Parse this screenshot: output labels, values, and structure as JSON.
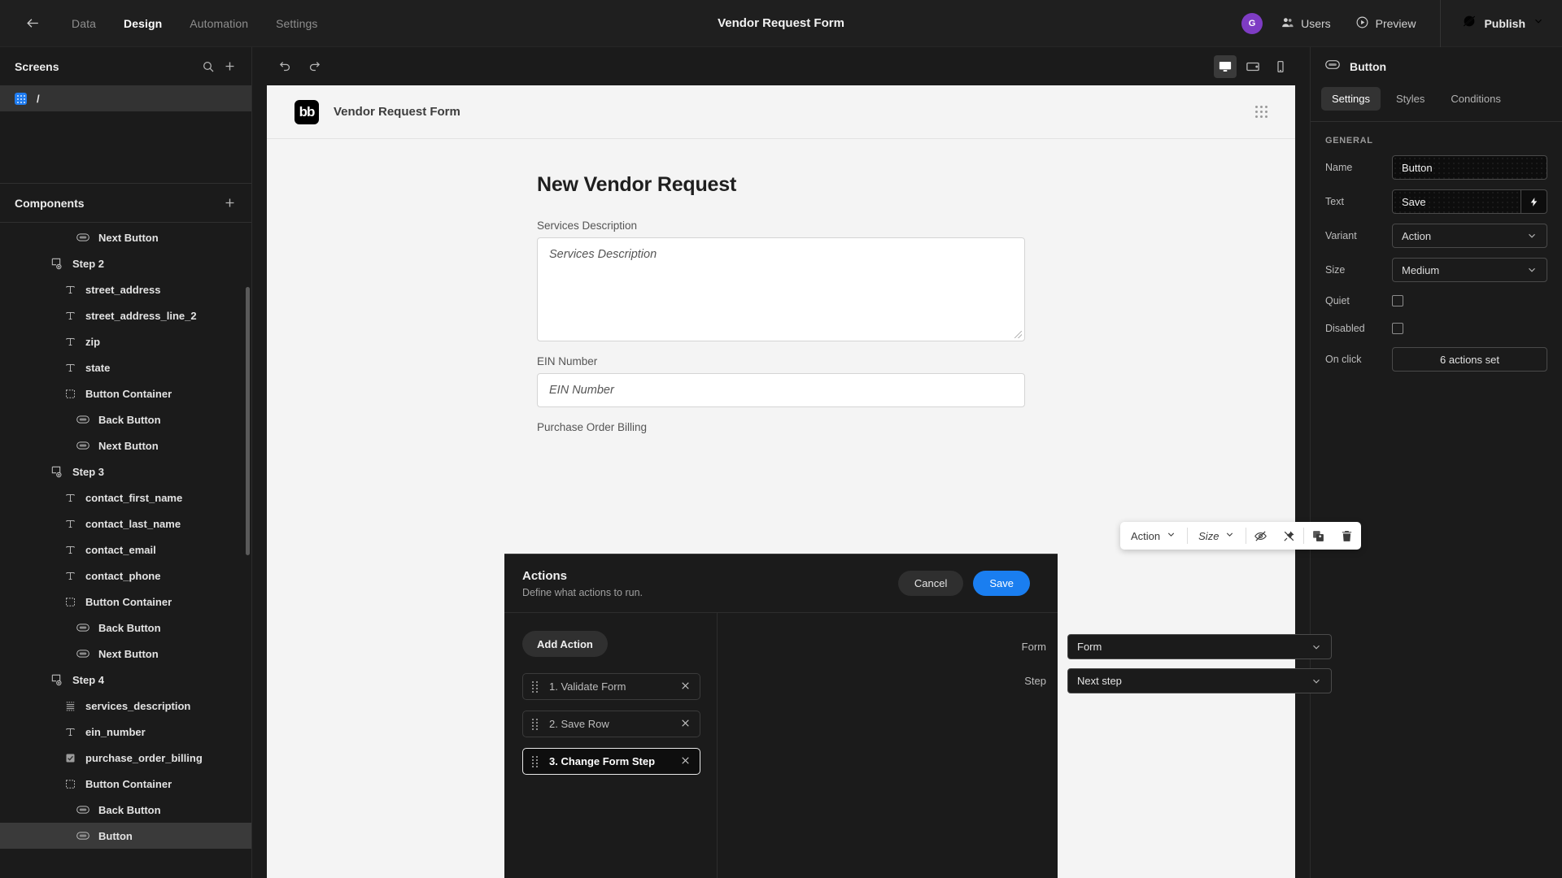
{
  "topbar": {
    "back_icon": "arrow-left-icon",
    "nav": [
      {
        "label": "Data",
        "active": false
      },
      {
        "label": "Design",
        "active": true
      },
      {
        "label": "Automation",
        "active": false
      },
      {
        "label": "Settings",
        "active": false
      }
    ],
    "title": "Vendor Request Form",
    "avatar_initial": "G",
    "users_label": "Users",
    "preview_label": "Preview",
    "publish_label": "Publish"
  },
  "screens_panel": {
    "title": "Screens",
    "search_icon": "search-icon",
    "add_icon": "plus-icon",
    "items": [
      {
        "label": "/",
        "selected": true
      }
    ]
  },
  "components_panel": {
    "title": "Components",
    "add_icon": "plus-icon",
    "tree": [
      {
        "label": "Next Button",
        "icon": "button-icon",
        "indent": 3,
        "selected": false
      },
      {
        "label": "Step 2",
        "icon": "step-icon",
        "indent": 1,
        "selected": false
      },
      {
        "label": "street_address",
        "icon": "text-field-icon",
        "indent": 2,
        "selected": false
      },
      {
        "label": "street_address_line_2",
        "icon": "text-field-icon",
        "indent": 2,
        "selected": false
      },
      {
        "label": "zip",
        "icon": "text-field-icon",
        "indent": 2,
        "selected": false
      },
      {
        "label": "state",
        "icon": "text-field-icon",
        "indent": 2,
        "selected": false
      },
      {
        "label": "Button Container",
        "icon": "container-icon",
        "indent": 2,
        "selected": false
      },
      {
        "label": "Back Button",
        "icon": "button-icon",
        "indent": 3,
        "selected": false
      },
      {
        "label": "Next Button",
        "icon": "button-icon",
        "indent": 3,
        "selected": false
      },
      {
        "label": "Step 3",
        "icon": "step-icon",
        "indent": 1,
        "selected": false
      },
      {
        "label": "contact_first_name",
        "icon": "text-field-icon",
        "indent": 2,
        "selected": false
      },
      {
        "label": "contact_last_name",
        "icon": "text-field-icon",
        "indent": 2,
        "selected": false
      },
      {
        "label": "contact_email",
        "icon": "text-field-icon",
        "indent": 2,
        "selected": false
      },
      {
        "label": "contact_phone",
        "icon": "text-field-icon",
        "indent": 2,
        "selected": false
      },
      {
        "label": "Button Container",
        "icon": "container-icon",
        "indent": 2,
        "selected": false
      },
      {
        "label": "Back Button",
        "icon": "button-icon",
        "indent": 3,
        "selected": false
      },
      {
        "label": "Next Button",
        "icon": "button-icon",
        "indent": 3,
        "selected": false
      },
      {
        "label": "Step 4",
        "icon": "step-icon",
        "indent": 1,
        "selected": false
      },
      {
        "label": "services_description",
        "icon": "long-form-icon",
        "indent": 2,
        "selected": false
      },
      {
        "label": "ein_number",
        "icon": "text-field-icon",
        "indent": 2,
        "selected": false
      },
      {
        "label": "purchase_order_billing",
        "icon": "checkbox-icon",
        "indent": 2,
        "selected": false
      },
      {
        "label": "Button Container",
        "icon": "container-icon",
        "indent": 2,
        "selected": false
      },
      {
        "label": "Back Button",
        "icon": "button-icon",
        "indent": 3,
        "selected": false
      },
      {
        "label": "Button",
        "icon": "button-icon",
        "indent": 3,
        "selected": true
      }
    ]
  },
  "canvas_toolbar": {
    "undo_icon": "undo-icon",
    "redo_icon": "redo-icon",
    "devices": [
      {
        "name": "desktop-icon",
        "active": true
      },
      {
        "name": "tablet-icon",
        "active": false
      },
      {
        "name": "mobile-icon",
        "active": false
      }
    ]
  },
  "preview": {
    "logo_text": "bb",
    "app_name": "Vendor Request Form",
    "menu_icon": "grid-dots-icon",
    "form_title": "New Vendor Request",
    "fields": [
      {
        "label": "Services Description",
        "placeholder": "Services Description",
        "type": "textarea"
      },
      {
        "label": "EIN Number",
        "placeholder": "EIN Number",
        "type": "text"
      },
      {
        "label": "Purchase Order Billing",
        "placeholder": "",
        "type": "checkbox"
      }
    ]
  },
  "float_toolbar": {
    "variant_label": "Action",
    "size_label": "Size",
    "eye_icon": "eye-off-icon",
    "eject_icon": "unpin-icon",
    "duplicate_icon": "duplicate-icon",
    "delete_icon": "trash-icon"
  },
  "drawer": {
    "title": "Actions",
    "subtitle": "Define what actions to run.",
    "cancel_label": "Cancel",
    "save_label": "Save",
    "add_action_label": "Add Action",
    "actions": [
      {
        "label": "1. Validate Form",
        "selected": false
      },
      {
        "label": "2. Save Row",
        "selected": false
      },
      {
        "label": "3. Change Form Step",
        "selected": true
      }
    ],
    "config": [
      {
        "label": "Form",
        "value": "Form"
      },
      {
        "label": "Step",
        "value": "Next step"
      }
    ]
  },
  "properties": {
    "component_name": "Button",
    "component_icon": "button-icon",
    "tabs": [
      {
        "label": "Settings",
        "active": true
      },
      {
        "label": "Styles",
        "active": false
      },
      {
        "label": "Conditions",
        "active": false
      }
    ],
    "section_title": "GENERAL",
    "rows": [
      {
        "label": "Name",
        "value": "Button",
        "type": "input"
      },
      {
        "label": "Text",
        "value": "Save",
        "type": "input-binding"
      },
      {
        "label": "Variant",
        "value": "Action",
        "type": "select"
      },
      {
        "label": "Size",
        "value": "Medium",
        "type": "select"
      },
      {
        "label": "Quiet",
        "value": "",
        "type": "checkbox"
      },
      {
        "label": "Disabled",
        "value": "",
        "type": "checkbox"
      },
      {
        "label": "On click",
        "value": "6 actions set",
        "type": "button"
      }
    ]
  },
  "colors": {
    "accent_blue": "#1a7ef0",
    "avatar_purple": "#7e3cc4",
    "screen_icon_blue": "#1f7cf0",
    "panel_bg": "#1b1b1b",
    "canvas_bg": "#f4f4f4"
  }
}
